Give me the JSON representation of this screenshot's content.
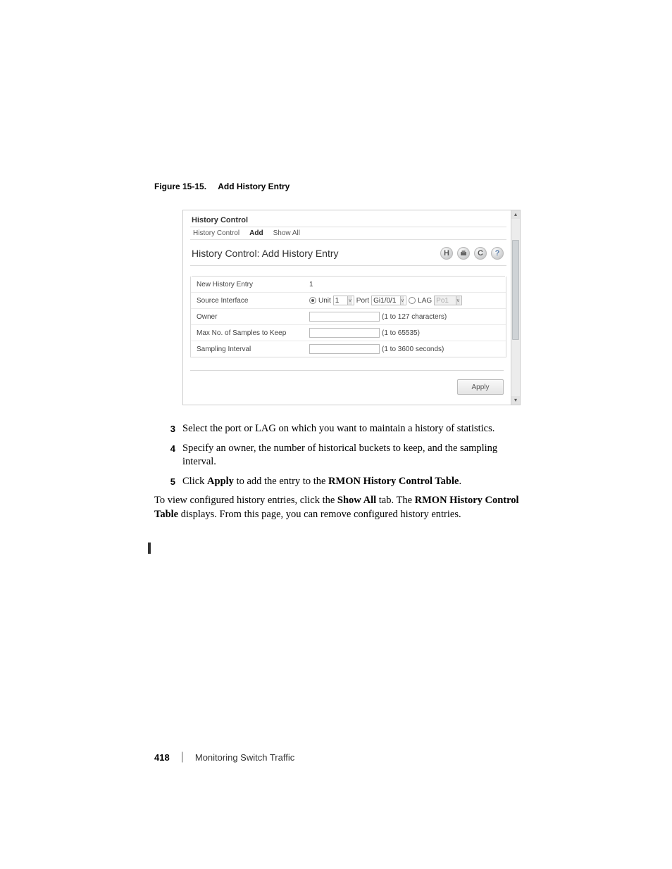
{
  "figure": {
    "caption_prefix": "Figure 15-15.",
    "caption_title": "Add History Entry"
  },
  "screenshot": {
    "panel_title": "History Control",
    "tabs": [
      "History Control",
      "Add",
      "Show All"
    ],
    "active_tab": "Add",
    "section_title": "History Control: Add History Entry",
    "icons": {
      "save": "H",
      "print": "■",
      "refresh": "C",
      "help": "?"
    },
    "rows": {
      "new_entry": {
        "label": "New History Entry",
        "value": "1"
      },
      "source": {
        "label": "Source Interface",
        "unit_label": "Unit",
        "unit_value": "1",
        "port_label": "Port",
        "port_value": "Gi1/0/1",
        "lag_label": "LAG",
        "lag_value": "Po1"
      },
      "owner": {
        "label": "Owner",
        "hint": "(1 to 127 characters)"
      },
      "samples": {
        "label": "Max No. of Samples to Keep",
        "hint": "(1 to 65535)"
      },
      "interval": {
        "label": "Sampling Interval",
        "hint": "(1 to 3600 seconds)"
      }
    },
    "apply": "Apply"
  },
  "steps": {
    "s3": {
      "num": "3",
      "text": "Select the port or LAG on which you want to maintain a history of statistics."
    },
    "s4": {
      "num": "4",
      "text": "Specify an owner, the number of historical buckets to keep, and the sampling interval."
    },
    "s5": {
      "num": "5",
      "t1": "Click ",
      "b1": "Apply",
      "t2": " to add the entry to the ",
      "b2": "RMON History Control Table",
      "t3": "."
    }
  },
  "paragraph": {
    "t1": "To view configured history entries, click the ",
    "b1": "Show All",
    "t2": " tab. The ",
    "b2": "RMON History Control Table",
    "t3": " displays. From this page, you can remove configured history entries."
  },
  "footer": {
    "page": "418",
    "section": "Monitoring Switch Traffic"
  }
}
